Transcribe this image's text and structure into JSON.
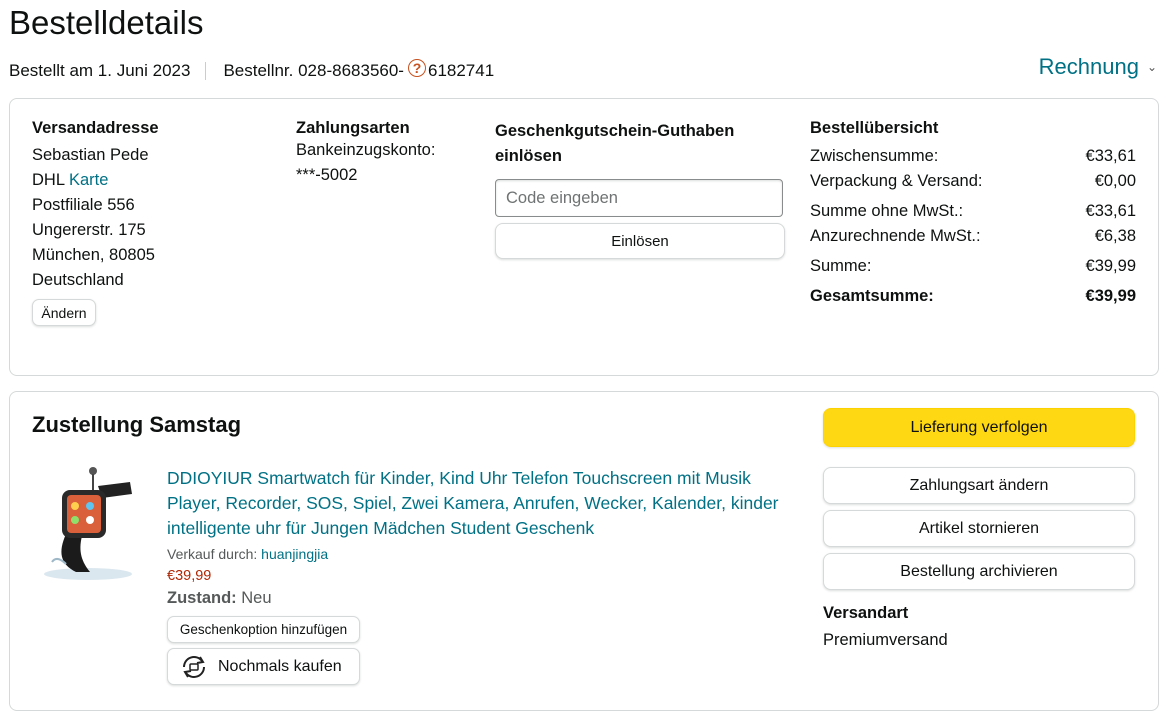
{
  "header": {
    "title": "Bestelldetails",
    "ordered": "Bestellt am 1. Juni 2023",
    "order_prefix": "Bestellnr. 028-8683560-",
    "order_suffix": "6182741",
    "invoice": "Rechnung",
    "invoice_chevron_icon": "chevron-down-icon"
  },
  "shipping": {
    "heading": "Versandadresse",
    "name": "Sebastian Pede",
    "carrier": "DHL",
    "map_link": "Karte",
    "line1": "Postfiliale 556",
    "line2": "Ungererstr. 175",
    "line3": "München, 80805",
    "line4": "Deutschland",
    "change_button": "Ändern"
  },
  "payment": {
    "heading": "Zahlungsarten",
    "method": "Bankeinzugskonto:",
    "account": "***-5002"
  },
  "giftcard": {
    "heading_line1": "Geschenkgutschein-Guthaben",
    "heading_line2": "einlösen",
    "placeholder": "Code eingeben",
    "redeem_button": "Einlösen"
  },
  "summary": {
    "heading": "Bestellübersicht",
    "rows": [
      {
        "label": "Zwischensumme:",
        "value": "€33,61"
      },
      {
        "label": "Verpackung & Versand:",
        "value": "€0,00"
      },
      {
        "label": "Summe ohne MwSt.:",
        "value": "€33,61"
      },
      {
        "label": "Anzurechnende MwSt.:",
        "value": "€6,38"
      },
      {
        "label": "Summe:",
        "value": "€39,99"
      },
      {
        "label": "Gesamtsumme:",
        "value": "€39,99"
      }
    ]
  },
  "delivery": {
    "title": "Zustellung Samstag",
    "product_line1": "DDIOYIUR Smartwatch für Kinder, Kind Uhr Telefon Touchscreen mit Musik",
    "product_line2": "Player, Recorder, SOS, Spiel, Zwei Kamera, Anrufen, Wecker, Kalender, kinder",
    "product_line3": "intelligente uhr für Jungen Mädchen Student Geschenk",
    "sold_by_label": "Verkauf durch:",
    "seller": "huanjingjia",
    "price": "€39,99",
    "condition_label": "Zustand:",
    "condition": "Neu",
    "gift_button": "Geschenkoption hinzufügen",
    "buy_again_button": "Nochmals kaufen",
    "buy_again_icon": "refresh-cart-icon",
    "product_image_icon": "smartwatch-image"
  },
  "actions": {
    "track": "Lieferung verfolgen",
    "change_payment": "Zahlungsart ändern",
    "cancel": "Artikel stornieren",
    "archive": "Bestellung archivieren",
    "shipping_method_heading": "Versandart",
    "shipping_method": "Premiumversand"
  },
  "colors": {
    "link": "#007185",
    "price": "#B12704",
    "yellow_button": "#FFD814"
  }
}
